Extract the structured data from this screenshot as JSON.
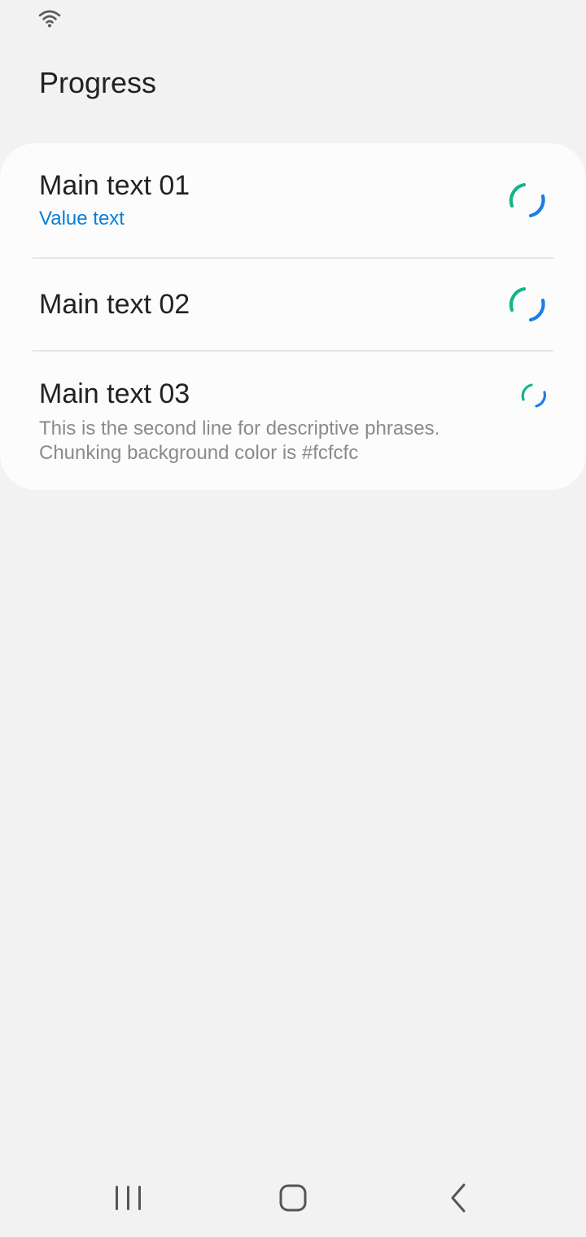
{
  "status_bar": {
    "wifi_icon": "wifi-icon"
  },
  "header": {
    "title": "Progress"
  },
  "list": {
    "background_color": "#fcfcfc",
    "items": [
      {
        "main_text": "Main text 01",
        "value_text": "Value text",
        "value_color": "#0a7ed6",
        "indicator": "progress-spinner-large"
      },
      {
        "main_text": "Main text 02",
        "indicator": "progress-spinner-large"
      },
      {
        "main_text": "Main text 03",
        "sub_text_line1": "This is the second line for descriptive phrases.",
        "sub_text_line2": "Chunking background color is #fcfcfc",
        "indicator": "progress-spinner-small"
      }
    ]
  },
  "spinner_colors": {
    "start": "#13b58a",
    "end": "#1a7ee6"
  },
  "nav_bar": {
    "recents_icon": "recents-icon",
    "home_icon": "home-icon",
    "back_icon": "back-icon"
  }
}
